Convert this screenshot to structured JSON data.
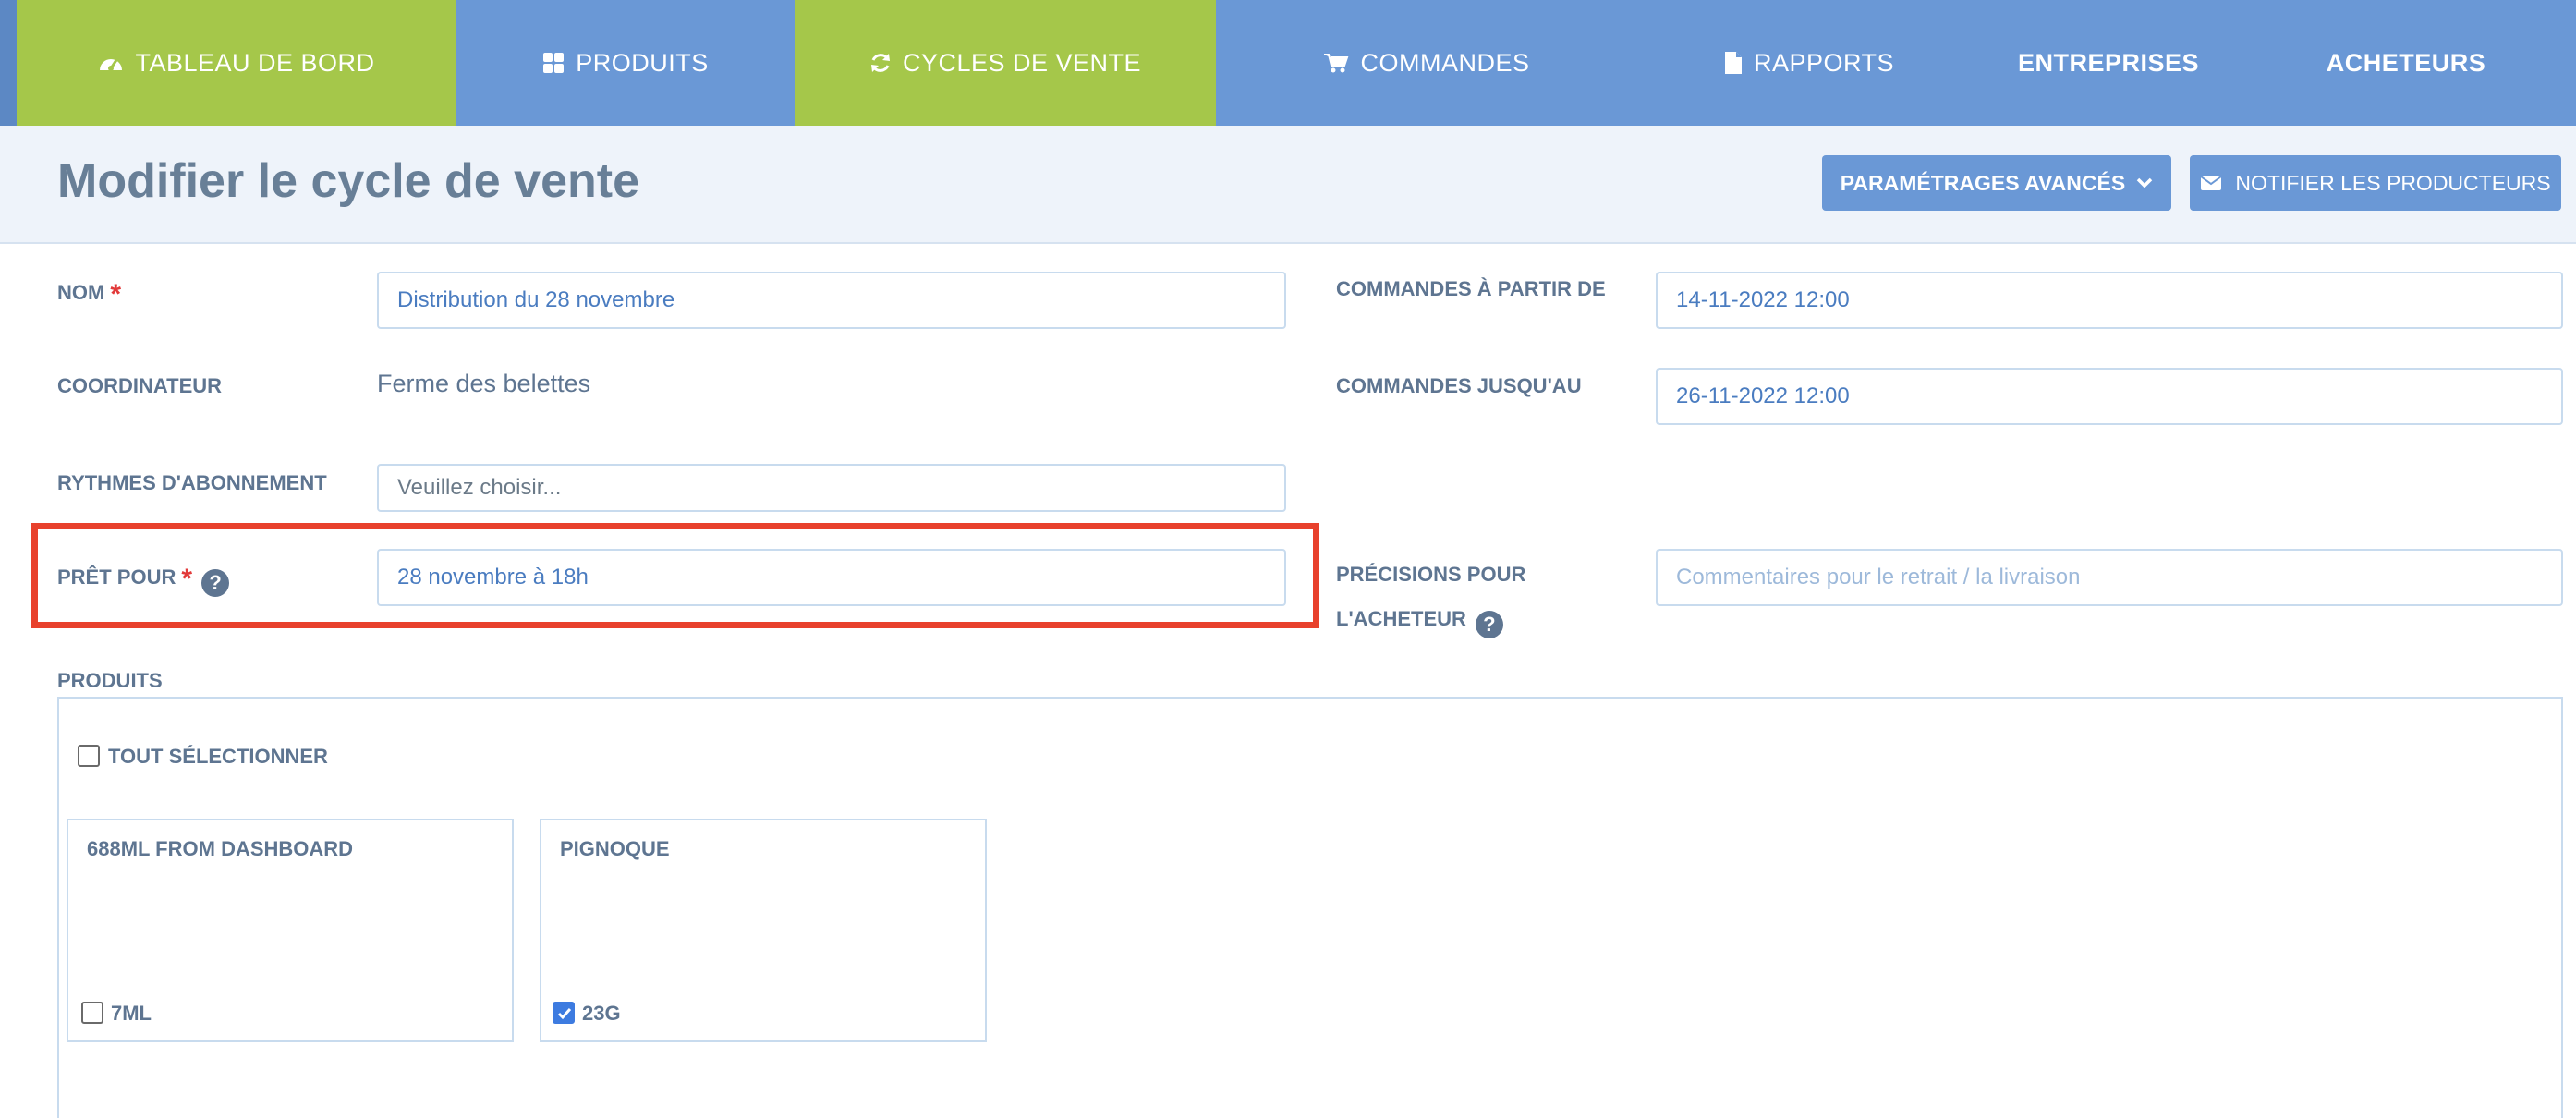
{
  "nav": {
    "tabs": [
      {
        "label": "TABLEAU DE BORD",
        "icon": "dashboard-icon",
        "active": true
      },
      {
        "label": "PRODUITS",
        "icon": "grid-icon",
        "active": false
      },
      {
        "label": "CYCLES DE VENTE",
        "icon": "refresh-icon",
        "active": true
      },
      {
        "label": "COMMANDES",
        "icon": "cart-icon",
        "active": false
      },
      {
        "label": "RAPPORTS",
        "icon": "document-icon",
        "active": false
      },
      {
        "label": "ENTREPRISES",
        "active": false
      },
      {
        "label": "ACHETEURS",
        "active": false
      }
    ],
    "active_color": "#a5c74a",
    "bar_color": "#6a98d6"
  },
  "header": {
    "title": "Modifier le cycle de vente",
    "advanced_button": "PARAMÉTRAGES AVANCÉS",
    "notify_button": "NOTIFIER LES PRODUCTEURS"
  },
  "form": {
    "name": {
      "label": "NOM",
      "value": "Distribution du 28 novembre"
    },
    "coordinator": {
      "label": "COORDINATEUR",
      "value": "Ferme des belettes"
    },
    "rhythms": {
      "label": "RYTHMES D'ABONNEMENT",
      "placeholder": "Veuillez choisir..."
    },
    "ready_for": {
      "label": "PRÊT POUR",
      "value": "28 novembre à 18h"
    },
    "orders_from": {
      "label": "COMMANDES À PARTIR DE",
      "value": "14-11-2022 12:00"
    },
    "orders_until": {
      "label": "COMMANDES JUSQU'AU",
      "value": "26-11-2022 12:00"
    },
    "buyer_notes": {
      "label_line1": "PRÉCISIONS POUR",
      "label_line2": "L'ACHETEUR",
      "placeholder": "Commentaires pour le retrait / la livraison"
    },
    "required_mark": "*",
    "help_mark": "?"
  },
  "products": {
    "label": "PRODUITS",
    "select_all": "TOUT SÉLECTIONNER",
    "select_all_checked": false,
    "cards": [
      {
        "title": "688ML FROM DASHBOARD",
        "variant": "7ML",
        "checked": false
      },
      {
        "title": "PIGNOQUE",
        "variant": "23G",
        "checked": true
      }
    ]
  },
  "highlight_color": "#e8412c"
}
